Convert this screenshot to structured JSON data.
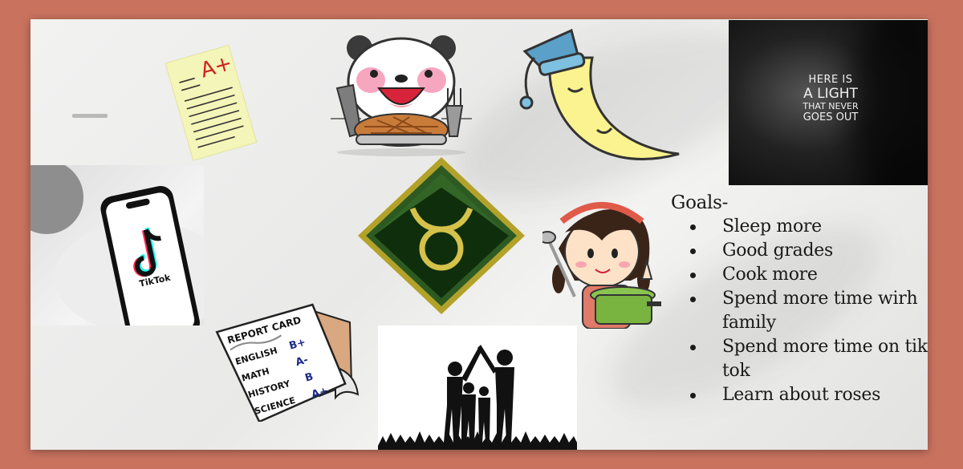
{
  "photo_texts": {
    "tiktok_logo": "TikTok",
    "light_quote": {
      "line1": "HERE IS",
      "line2": "A LIGHT",
      "line3": "THAT NEVER",
      "line4": "GOES OUT"
    }
  },
  "a_plus_paper": {
    "grade": "A+"
  },
  "report_card": {
    "title": "REPORT CARD",
    "rows": [
      {
        "subject": "ENGLISH",
        "grade": "B+"
      },
      {
        "subject": "MATH",
        "grade": "A-"
      },
      {
        "subject": "HISTORY",
        "grade": "B"
      },
      {
        "subject": "SCIENCE",
        "grade": "A+"
      }
    ]
  },
  "goals": {
    "title": "Goals-",
    "items": [
      "Sleep more",
      "Good grades",
      "Cook more",
      "Spend more time wirh family",
      "Spend more time on tik tok",
      "Learn about roses"
    ]
  },
  "colors": {
    "background": "#c9735f",
    "board": "#efefee",
    "grade_red": "#cc2222",
    "report_blue": "#1a2a8a",
    "taurus_green": "#2c5a22",
    "taurus_gold": "#c8b43a"
  }
}
